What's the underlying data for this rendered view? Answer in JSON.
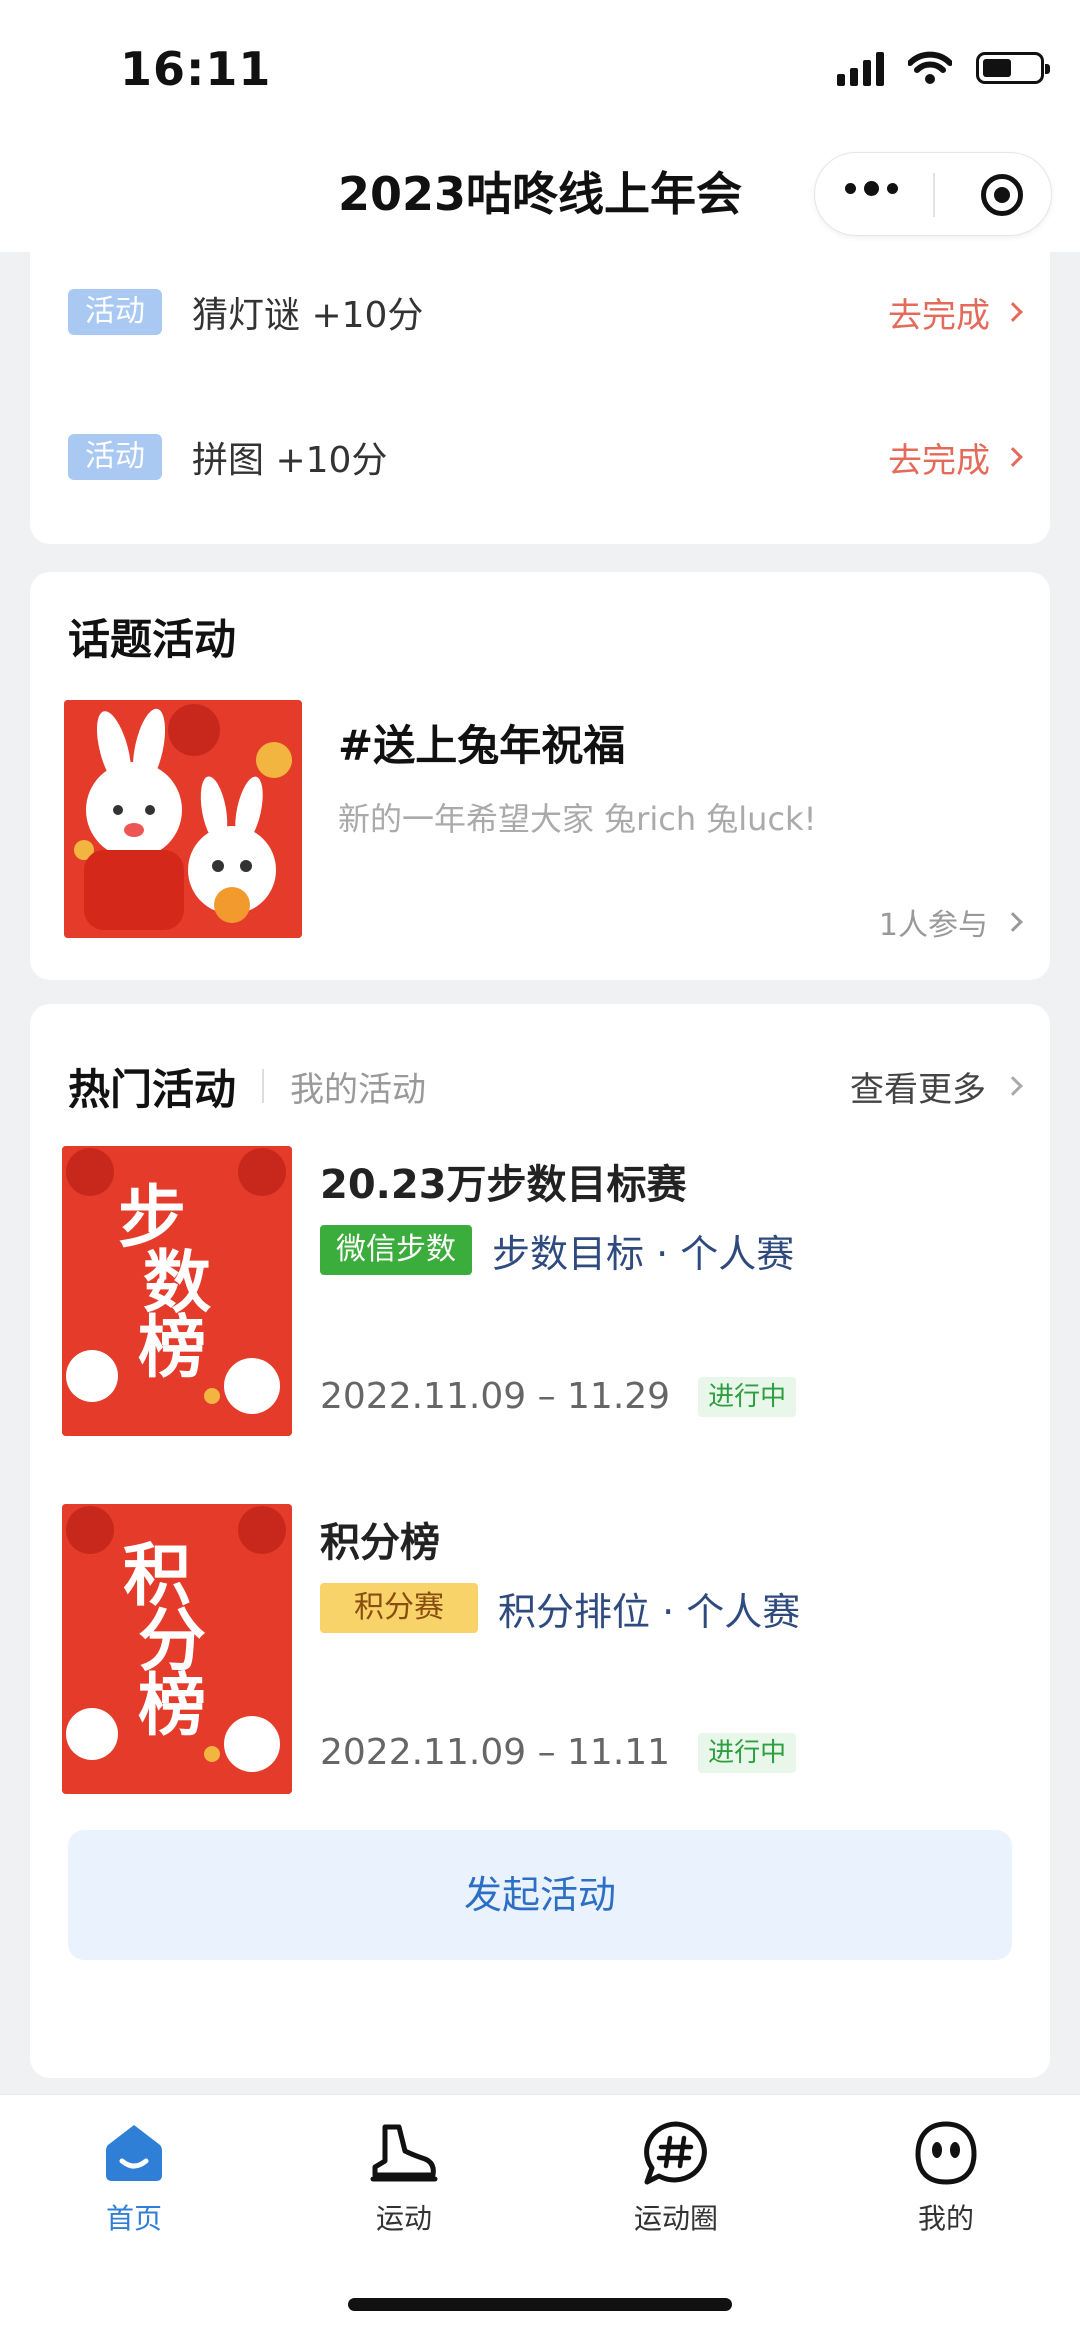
{
  "status_bar": {
    "time": "16:11"
  },
  "nav": {
    "title": "2023咕咚线上年会"
  },
  "tasks": [
    {
      "tag": "活动",
      "label": "猜灯谜 +10分",
      "action": "去完成"
    },
    {
      "tag": "活动",
      "label": "拼图 +10分",
      "action": "去完成"
    }
  ],
  "topic_section": {
    "title": "话题活动",
    "topic": {
      "name": "#送上兔年祝福",
      "desc": "新的一年希望大家 兔rich 兔luck!",
      "participants": "1人参与"
    }
  },
  "hot_section": {
    "title": "热门活动",
    "mine_tab": "我的活动",
    "more": "查看更多",
    "activities": [
      {
        "poster_text": [
          "步",
          "数",
          "榜"
        ],
        "name": "20.23万步数目标赛",
        "tag": "微信步数",
        "type": "步数目标 · 个人赛",
        "date": "2022.11.09 – 11.29",
        "status": "进行中"
      },
      {
        "poster_text": [
          "积",
          "分",
          "榜"
        ],
        "name": "积分榜",
        "tag": "积分赛",
        "type": "积分排位 · 个人赛",
        "date": "2022.11.09 – 11.11",
        "status": "进行中"
      }
    ],
    "launch_button": "发起活动"
  },
  "tab_bar": {
    "items": [
      {
        "label": "首页",
        "icon": "home-icon",
        "active": true
      },
      {
        "label": "运动",
        "icon": "running-shoe-icon",
        "active": false
      },
      {
        "label": "运动圈",
        "icon": "hashtag-bubble-icon",
        "active": false
      },
      {
        "label": "我的",
        "icon": "profile-face-icon",
        "active": false
      }
    ]
  },
  "colors": {
    "accent": "#2f7fd6",
    "action_red": "#e46a5a",
    "poster_red": "#e53b2a"
  }
}
